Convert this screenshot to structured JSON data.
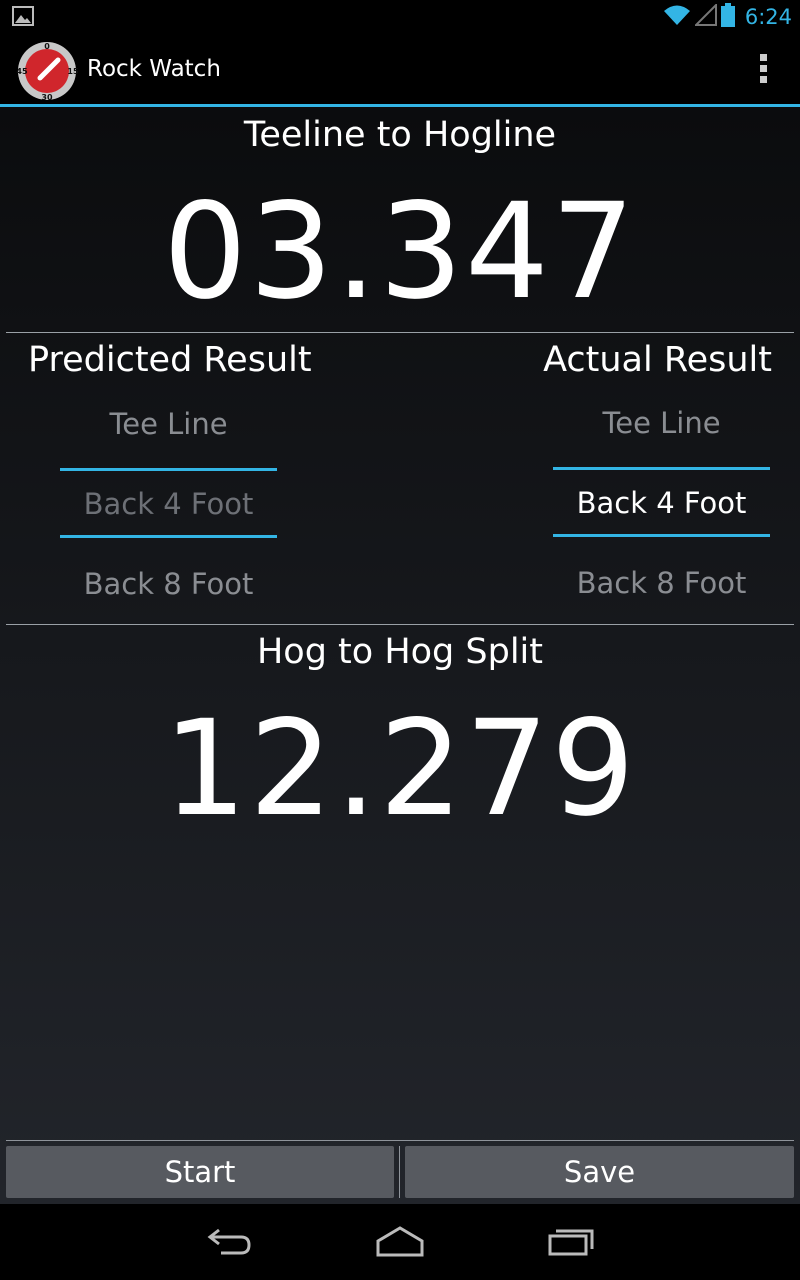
{
  "status_bar": {
    "time": "6:24",
    "icons": [
      "image-notification-icon",
      "wifi-icon",
      "signal-icon",
      "battery-icon"
    ],
    "accent_color": "#33b5e5"
  },
  "action_bar": {
    "app_title": "Rock Watch",
    "logo_marks": {
      "top": "0",
      "right": "15",
      "bottom": "30",
      "left": "45"
    },
    "overflow_icon": "overflow-menu-icon"
  },
  "main": {
    "teeline_title": "Teeline to Hogline",
    "teeline_time": "03.347",
    "predicted": {
      "title": "Predicted Result",
      "items": [
        "Tee Line",
        "Back 4 Foot",
        "Back 8 Foot"
      ],
      "selected": "Back 4 Foot"
    },
    "actual": {
      "title": "Actual Result",
      "items": [
        "Tee Line",
        "Back 4 Foot",
        "Back 8 Foot"
      ],
      "selected": "Back 4 Foot"
    },
    "hog_title": "Hog to Hog Split",
    "hog_time": "12.279"
  },
  "buttons": {
    "start_label": "Start",
    "save_label": "Save"
  },
  "nav_bar": {
    "icons": [
      "back-icon",
      "home-icon",
      "recent-apps-icon"
    ]
  }
}
